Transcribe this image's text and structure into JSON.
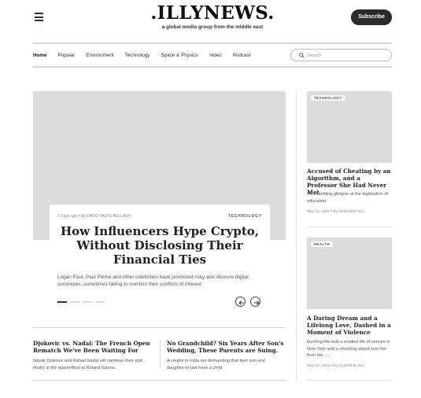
{
  "header": {
    "logo": ".ILLYNEWS.",
    "tagline": "a global media group from the middle east",
    "subscribe_label": "Subscribe"
  },
  "nav": {
    "items": [
      "Home",
      "Popular",
      "Environment",
      "Technology",
      "Space & Physics",
      "Video",
      "Podcast"
    ],
    "active": "Home"
  },
  "search": {
    "placeholder": "Search",
    "value": ""
  },
  "hero": {
    "meta": "1 Days ago • By DAVID YAFFE-BELLANY",
    "tag": "TECHNOLOGY",
    "title": "How Influencers Hype Crypto, Without Disclosing Their Financial Ties",
    "description": "Logan Paul, Paul Pierce and other celebrities have promoted risky and obscure digital currencies, sometimes failing to mention their conflicts of interest.",
    "slides": 4,
    "active_slide": 1
  },
  "sub_stories": [
    {
      "title": "Djokovic vs. Nadal: The French Open Rematch We've Been Waiting For",
      "description": "Novak Djokovic and Rafael Nadal will continue their epic rivalry in the quarterfinal at Roland Garros."
    },
    {
      "title": "No Grandchild? Six Years After Son's Wedding, These Parents are Suing.",
      "description": "A couple in India are demanding that their son and daughter-in-law have a child."
    }
  ],
  "sidebar": [
    {
      "tag": "TECHNOLOGY",
      "title": "Accused of Cheating by an Algorithm, and a Professor She Had Never Met",
      "description": "An unsettling glimpse at the digitization of education.",
      "meta": "May 27, 2022 • By KASHMIR HILL"
    },
    {
      "tag": "HEALTH",
      "title": "A Daring Dream and a Lifelong Love, Dashed in a Moment of Violence",
      "description": "GuiYing Ma built a modest life of service in New York until a shocking attack tore her from her .....",
      "meta": "May 27, 2022 • By KASHMIR HILL"
    }
  ],
  "icons": {
    "menu": "hamburger-icon",
    "search": "search-icon",
    "prev": "arrow-left-icon",
    "next": "arrow-right-icon"
  },
  "colors": {
    "placeholder_image": "#dcdcdc",
    "subscribe_bg": "#2a2a2a"
  }
}
